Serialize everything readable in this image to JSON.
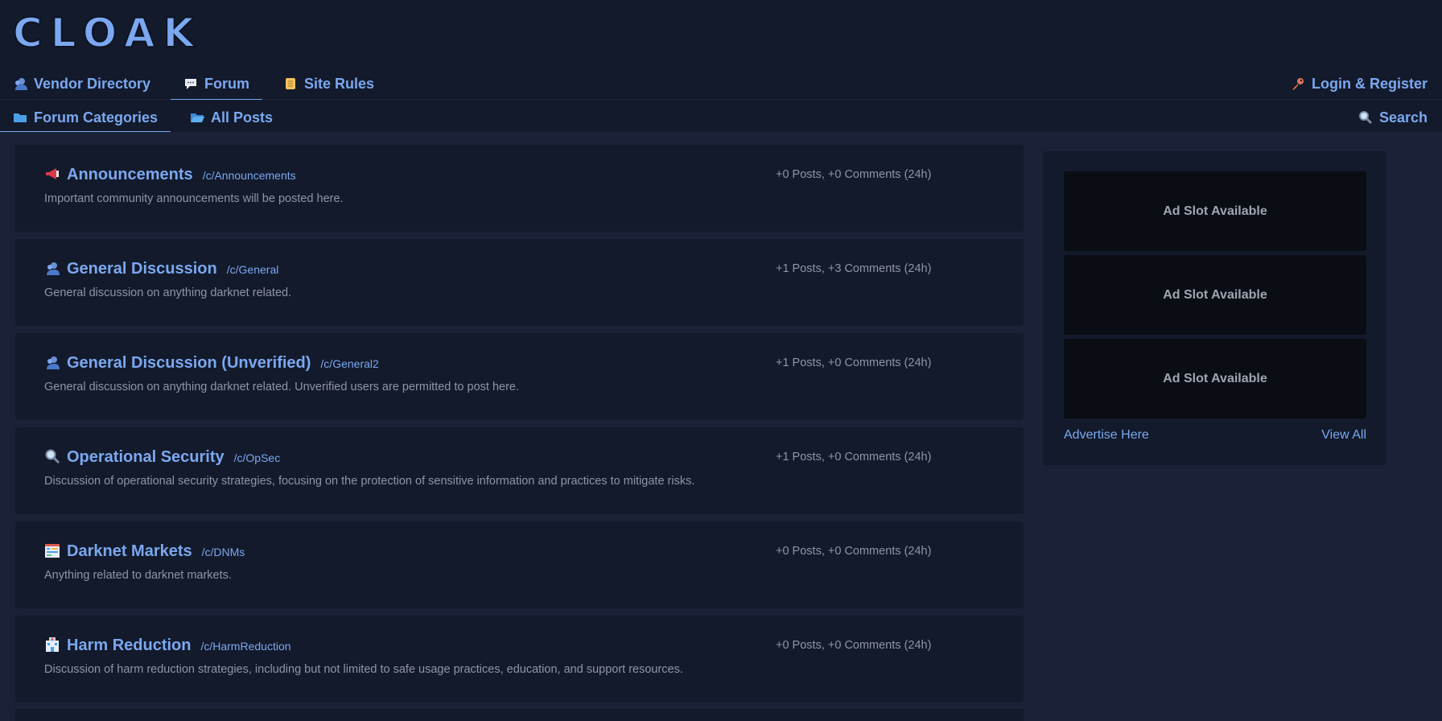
{
  "brand": {
    "logo_text": "CLOAK"
  },
  "nav": {
    "items": [
      {
        "label": "Vendor Directory",
        "icon": "vendor-icon"
      },
      {
        "label": "Forum",
        "icon": "speech-bubble-icon",
        "active": true
      },
      {
        "label": "Site Rules",
        "icon": "scroll-icon"
      }
    ],
    "login": {
      "label": "Login & Register",
      "icon": "key-icon"
    }
  },
  "subnav": {
    "items": [
      {
        "label": "Forum Categories",
        "icon": "folder-icon",
        "active": true
      },
      {
        "label": "All Posts",
        "icon": "open-folder-icon"
      }
    ],
    "search": {
      "label": "Search",
      "icon": "magnifier-icon"
    }
  },
  "categories": [
    {
      "title": "Announcements",
      "slug": "/c/Announcements",
      "stats": "+0 Posts, +0 Comments (24h)",
      "description": "Important community announcements will be posted here.",
      "icon": "megaphone-icon"
    },
    {
      "title": "General Discussion",
      "slug": "/c/General",
      "stats": "+1 Posts, +3 Comments (24h)",
      "description": "General discussion on anything darknet related.",
      "icon": "user-icon"
    },
    {
      "title": "General Discussion (Unverified)",
      "slug": "/c/General2",
      "stats": "+1 Posts, +0 Comments (24h)",
      "description": "General discussion on anything darknet related. Unverified users are permitted to post here.",
      "icon": "user-icon"
    },
    {
      "title": "Operational Security",
      "slug": "/c/OpSec",
      "stats": "+1 Posts, +0 Comments (24h)",
      "description": "Discussion of operational security strategies, focusing on the protection of sensitive information and practices to mitigate risks.",
      "icon": "magnifier-icon"
    },
    {
      "title": "Darknet Markets",
      "slug": "/c/DNMs",
      "stats": "+0 Posts, +0 Comments (24h)",
      "description": "Anything related to darknet markets.",
      "icon": "market-icon"
    },
    {
      "title": "Harm Reduction",
      "slug": "/c/HarmReduction",
      "stats": "+0 Posts, +0 Comments (24h)",
      "description": "Discussion of harm reduction strategies, including but not limited to safe usage practices, education, and support resources.",
      "icon": "hospital-icon"
    }
  ],
  "sidebar": {
    "ad_slots": [
      "Ad Slot Available",
      "Ad Slot Available",
      "Ad Slot Available"
    ],
    "advertise_label": "Advertise Here",
    "view_all_label": "View All"
  },
  "colors": {
    "accent": "#7ba8f0",
    "page_bg": "#1a2238",
    "card_bg": "#131a2b",
    "ad_bg": "#0a0d14",
    "muted_text": "#8e95a6"
  }
}
